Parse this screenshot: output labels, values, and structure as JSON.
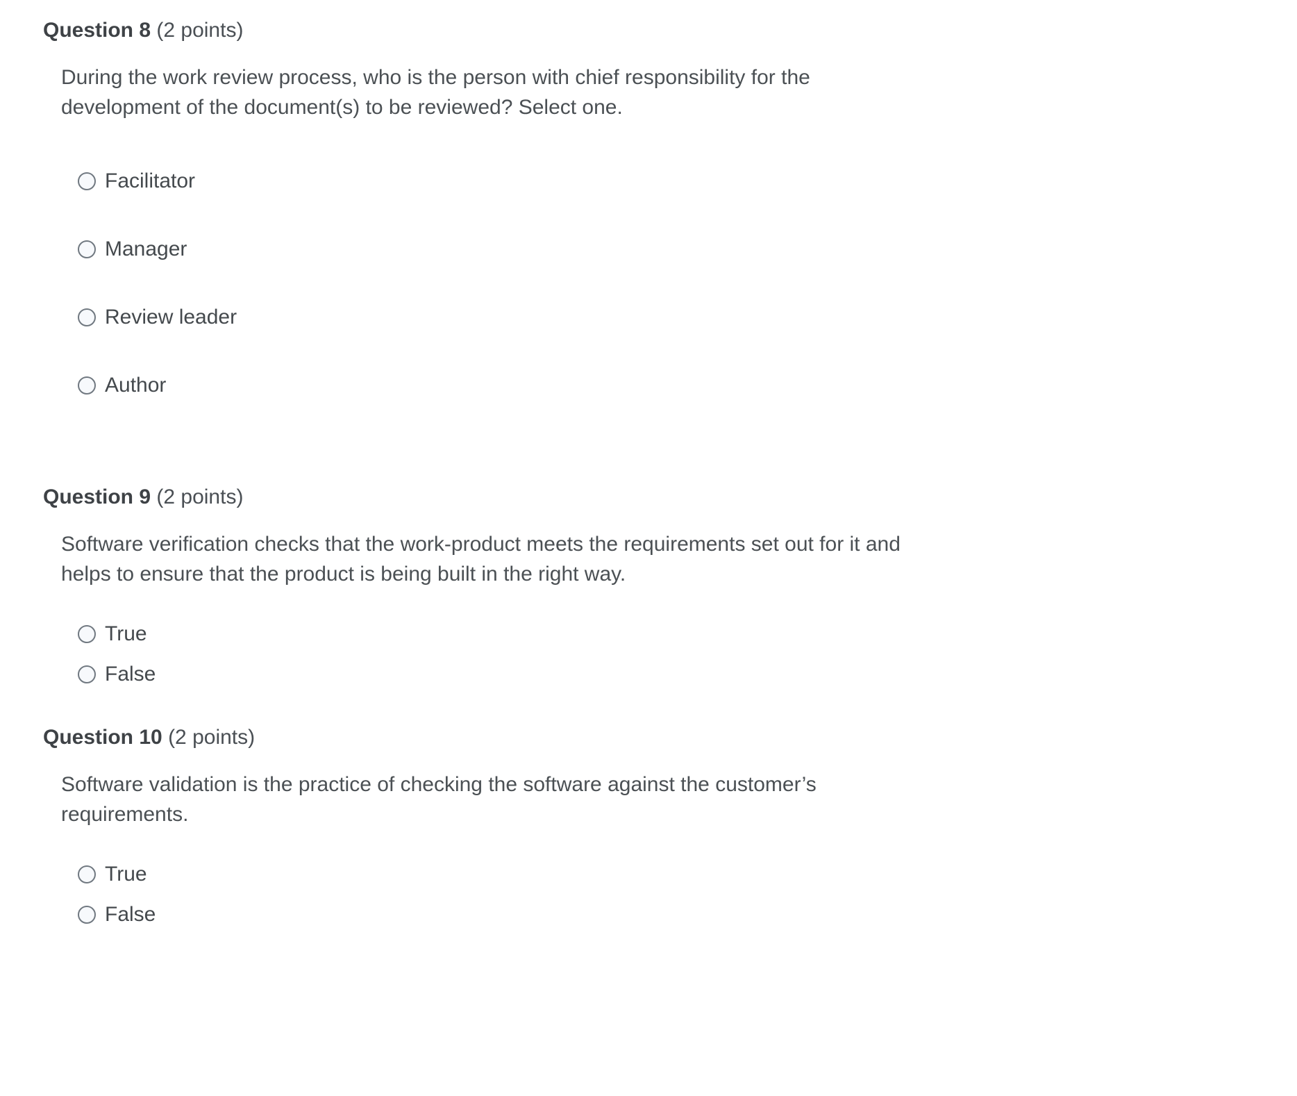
{
  "quiz": {
    "questions": [
      {
        "id": "q8",
        "label": "Question 8",
        "points": "(2 points)",
        "text": "During the work review process, who is the person with chief responsibility for the development of the document(s) to be reviewed? Select one.",
        "option_spacing": "spaced",
        "options": [
          {
            "label": "Facilitator",
            "selected": false
          },
          {
            "label": "Manager",
            "selected": false
          },
          {
            "label": "Review leader",
            "selected": false
          },
          {
            "label": "Author",
            "selected": false
          }
        ]
      },
      {
        "id": "q9",
        "label": "Question 9",
        "points": "(2 points)",
        "text": "Software verification checks that the work-product meets the requirements set out for it and helps to ensure that the product is being built in the right way.",
        "option_spacing": "tight",
        "options": [
          {
            "label": "True",
            "selected": false
          },
          {
            "label": "False",
            "selected": false
          }
        ]
      },
      {
        "id": "q10",
        "label": "Question 10",
        "points": "(2 points)",
        "text": "Software validation is the practice of checking the software against the customer’s requirements.",
        "option_spacing": "tight",
        "options": [
          {
            "label": "True",
            "selected": false
          },
          {
            "label": "False",
            "selected": false
          }
        ]
      }
    ]
  },
  "colors": {
    "page_background": "#ffffff",
    "heading_bold": "#3e4246",
    "body_text": "#4b5054",
    "option_text": "#44494d",
    "radio_border": "#707880",
    "radio_fill": "#f7f9fc"
  }
}
